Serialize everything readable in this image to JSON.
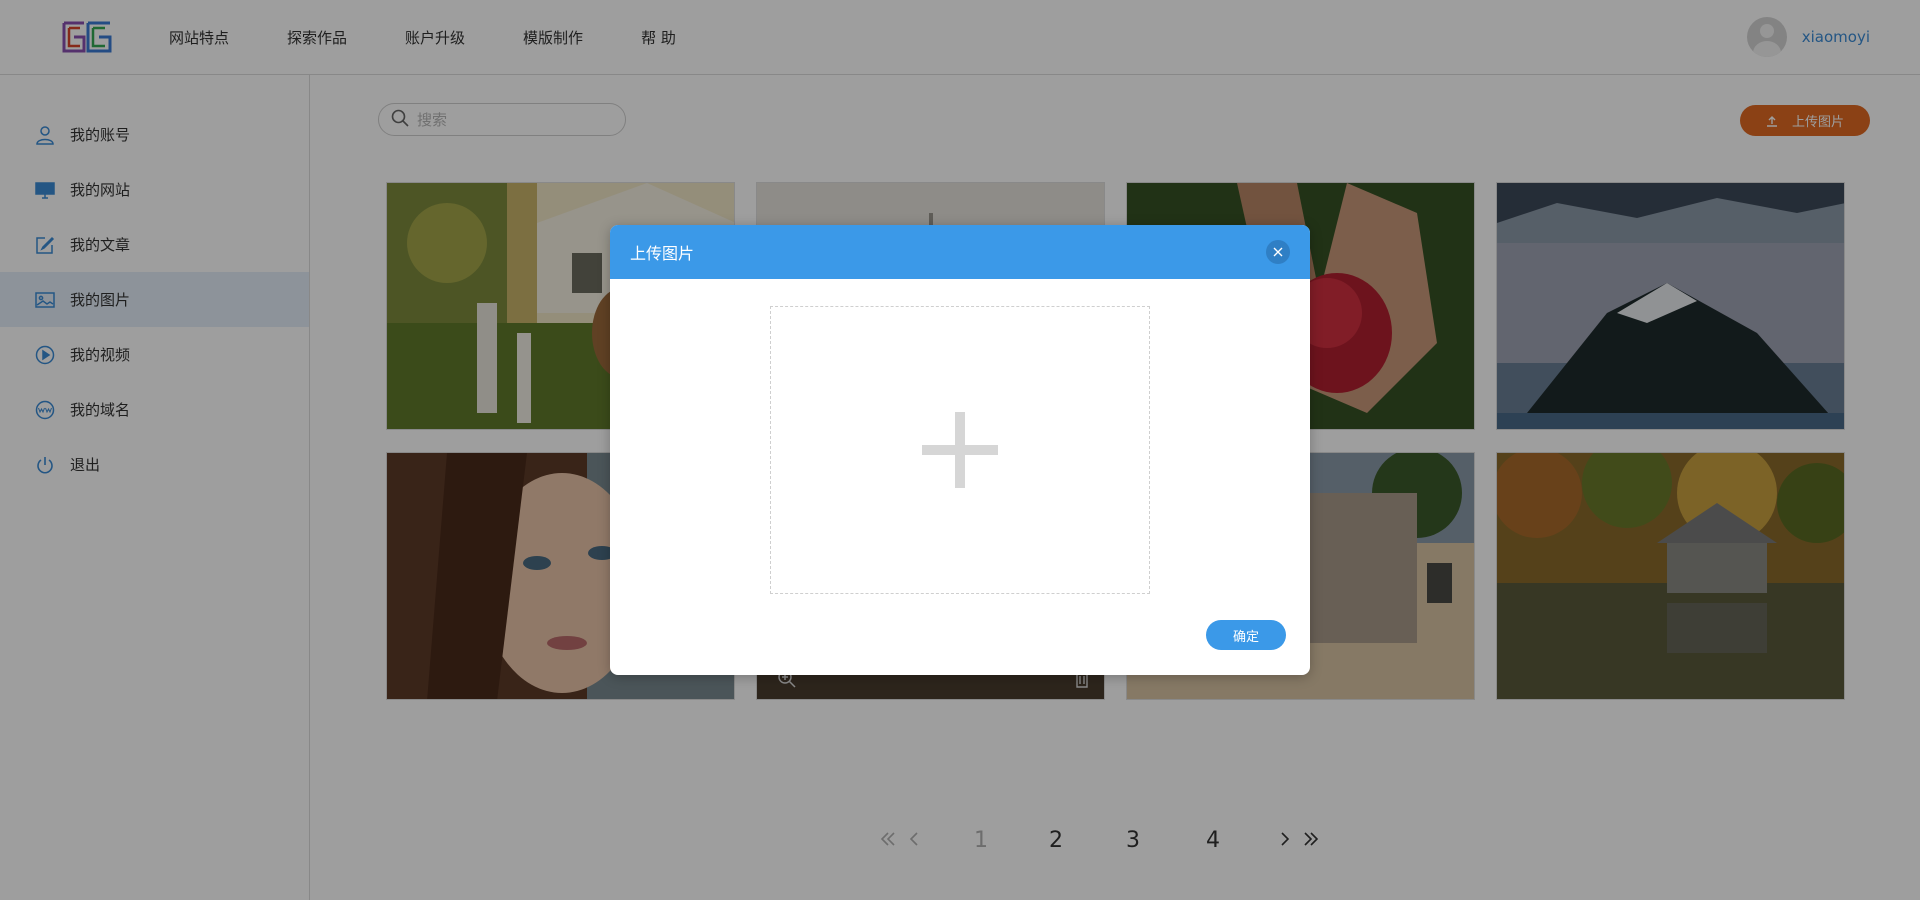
{
  "header": {
    "nav": [
      "网站特点",
      "探索作品",
      "账户升级",
      "模版制作",
      "帮 助"
    ],
    "username": "xiaomoyi"
  },
  "sidebar": {
    "items": [
      {
        "label": "我的账号",
        "icon": "user-icon",
        "active": false
      },
      {
        "label": "我的网站",
        "icon": "monitor-icon",
        "active": false
      },
      {
        "label": "我的文章",
        "icon": "edit-icon",
        "active": false
      },
      {
        "label": "我的图片",
        "icon": "image-icon",
        "active": true
      },
      {
        "label": "我的视频",
        "icon": "play-icon",
        "active": false
      },
      {
        "label": "我的域名",
        "icon": "www-icon",
        "active": false
      },
      {
        "label": "退出",
        "icon": "power-icon",
        "active": false
      }
    ]
  },
  "toolbar": {
    "search_placeholder": "搜索",
    "upload_label": "上传图片"
  },
  "gallery": {
    "images": [
      {
        "subject": "woman-picking-flowers"
      },
      {
        "subject": "foggy-tower"
      },
      {
        "subject": "hands-holding-raspberries"
      },
      {
        "subject": "mountain-lake-island"
      },
      {
        "subject": "woman-portrait"
      },
      {
        "subject": "rustic-surface"
      },
      {
        "subject": "red-graffiti-building"
      },
      {
        "subject": "lake-boathouse-autumn"
      }
    ]
  },
  "pagination": {
    "pages": [
      "1",
      "2",
      "3",
      "4"
    ],
    "current": "1"
  },
  "modal": {
    "title": "上传图片",
    "confirm_label": "确定"
  },
  "colors": {
    "accent": "#3b99e8",
    "upload_button": "#e06a22",
    "username": "#3a8bd6"
  }
}
